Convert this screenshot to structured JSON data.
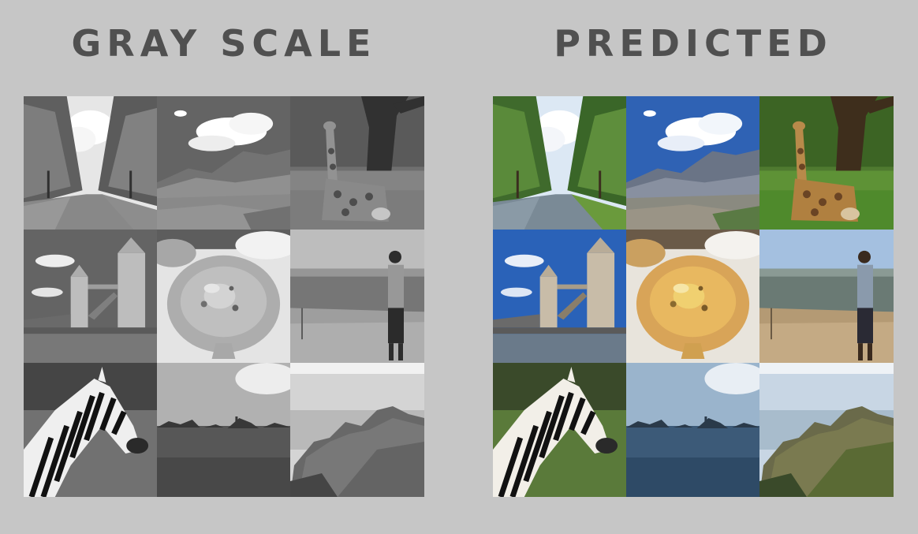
{
  "panels": {
    "left": {
      "title": "GRAY SCALE"
    },
    "right": {
      "title": "PREDICTED"
    }
  },
  "tiles": [
    {
      "subject": "tree-lined-path"
    },
    {
      "subject": "mountain-sky"
    },
    {
      "subject": "giraffe-under-tree"
    },
    {
      "subject": "tower-bridge"
    },
    {
      "subject": "pizza-bread"
    },
    {
      "subject": "man-at-cliff"
    },
    {
      "subject": "zebra"
    },
    {
      "subject": "lake-islands"
    },
    {
      "subject": "rocky-coast"
    }
  ]
}
